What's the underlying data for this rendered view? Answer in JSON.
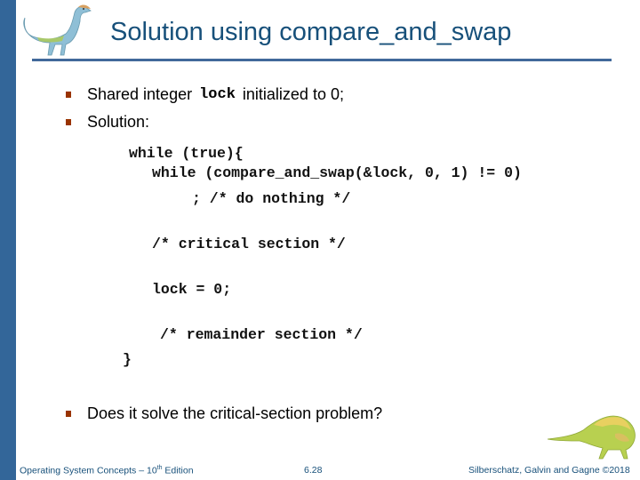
{
  "slide": {
    "title": "Solution using compare_and_swap",
    "bullets": [
      {
        "pre": "Shared integer",
        "code": "lock",
        "post": "initialized to 0;"
      },
      {
        "text": "Solution:"
      },
      {
        "text": "Does it solve the critical-section problem?"
      }
    ],
    "code_lines": [
      "while (true){",
      "while (compare_and_swap(&lock, 0, 1) != 0)",
      "; /* do nothing */",
      "/* critical section */",
      "lock = 0;",
      "/* remainder section */",
      "}"
    ]
  },
  "footer": {
    "left_prefix": "Operating System Concepts – 10",
    "left_sup": "th",
    "left_suffix": " Edition",
    "page": "6.28",
    "right": "Silberschatz, Galvin and Gagne ©2018"
  },
  "colors": {
    "accent_bar": "#336699",
    "title": "#17507a",
    "bullet": "#993300"
  },
  "icons": {
    "top_left": "dinosaur-logo-icon",
    "bottom_right": "dinosaur-logo-icon"
  }
}
